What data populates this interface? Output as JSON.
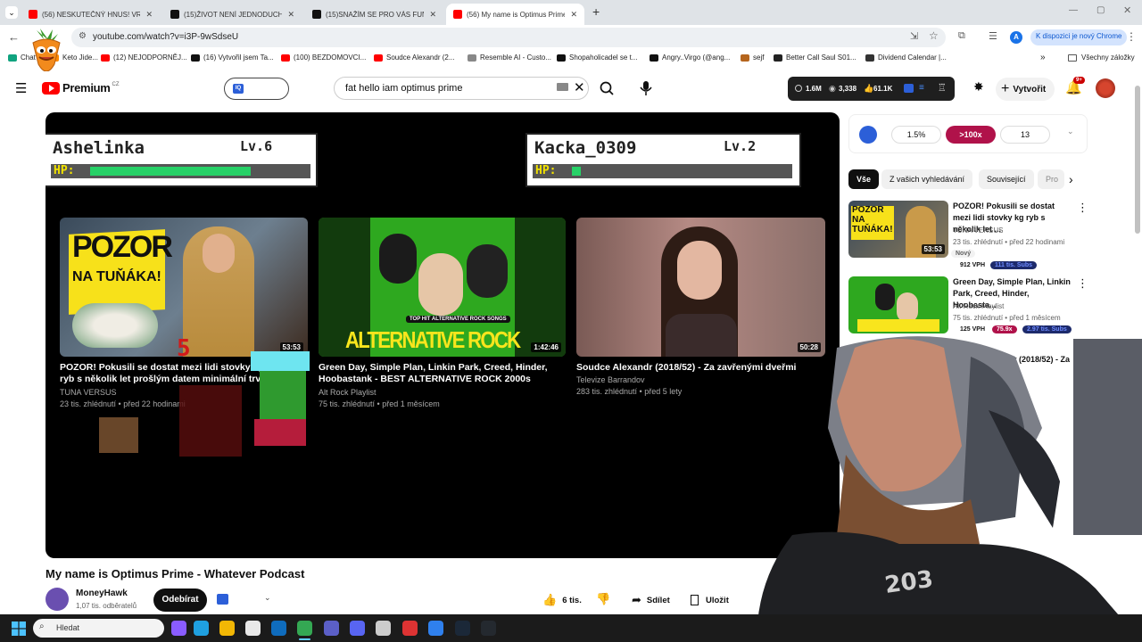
{
  "browser": {
    "tabs": [
      {
        "title": "(56) NESKUTEČNÝ HNUS! VRCH",
        "icon": "youtube-icon",
        "color": "#ff0000",
        "active": false
      },
      {
        "title": "(15)ŽIVOT NENÍ JEDNODUCHÝ",
        "icon": "tiktok-icon",
        "color": "#111111",
        "active": false
      },
      {
        "title": "(15)SNAŽÍM SE PRO VÁS FUNG",
        "icon": "tiktok-icon",
        "color": "#111111",
        "active": false
      },
      {
        "title": "(56) My name is Optimus Prime",
        "icon": "youtube-icon",
        "color": "#ff0000",
        "active": true
      }
    ],
    "new_tab": "+",
    "url": "youtube.com/watch?v=i3P-9wSdseU",
    "profile_letter": "A",
    "chrome_update": "K dispozici je nový Chrome",
    "bookmarks": [
      {
        "label": "Chat",
        "color": "#10a37f"
      },
      {
        "label": "Keto Jide...",
        "color": "#ff8a00"
      },
      {
        "label": "(12) NEJODPORNĚJ...",
        "color": "#ff0000"
      },
      {
        "label": "(16) Vytvořil jsem Ta...",
        "color": "#111111"
      },
      {
        "label": "(100) BEZDOMOVCI...",
        "color": "#ff0000"
      },
      {
        "label": "Soudce Alexandr (2...",
        "color": "#ff0000"
      },
      {
        "label": "Resemble AI - Custo...",
        "color": "#888888"
      },
      {
        "label": "Shopaholicadel se t...",
        "color": "#111111"
      },
      {
        "label": "Angry..Virgo (@ang...",
        "color": "#111111"
      },
      {
        "label": "sejf",
        "color": "#b5651d"
      },
      {
        "label": "Better Call Saul S01...",
        "color": "#222222"
      },
      {
        "label": "Dividend Calendar |...",
        "color": "#333333"
      }
    ],
    "bookmarks_overflow": "»",
    "all_bookmarks": "Všechny záložky"
  },
  "youtube": {
    "logo_text": "Premium",
    "logo_region": "CZ",
    "search_query": "fat hello iam optimus prime",
    "stats": {
      "views": "1.6M",
      "viewers": "3,338",
      "likes": "61.1K"
    },
    "create_label": "Vytvořit",
    "notifications": "9+",
    "iq_label": "IQ"
  },
  "player": {
    "hp_left": {
      "name": "Ashelinka",
      "level": "Lv.6",
      "hp_label": "HP:",
      "hp_fraction": 0.74
    },
    "hp_right": {
      "name": "Kacka_0309",
      "level": "Lv.2",
      "hp_label": "HP:",
      "hp_fraction": 0.04
    },
    "endcards": [
      {
        "title": "POZOR! Pokusili se dostat mezi lidi stovky kg ryb s několik let prošlým datem minimální trv",
        "channel": "TUNA VERSUS",
        "meta": "23 tis. zhlédnutí • před 22 hodinami",
        "duration": "53:53",
        "thumb_text1": "POZOR",
        "thumb_text2": "NA TUŇÁKA!"
      },
      {
        "title": "Green Day, Simple Plan, Linkin Park, Creed, Hinder, Hoobastank - BEST ALTERNATIVE ROCK 2000s",
        "channel": "Alt Rock Playlist",
        "meta": "75 tis. zhlédnutí • před 1 měsícem",
        "duration": "1:42:46",
        "thumb_text1": "ALTERNATIVE ROCK",
        "thumb_text2": "TOP HIT ALTERNATIVE ROCK SONGS"
      },
      {
        "title": "Soudce Alexandr (2018/52) - Za zavřenými dveřmi",
        "channel": "Televize Barrandov",
        "meta": "283 tis. zhlédnutí • před 5 lety",
        "duration": "50:28"
      }
    ],
    "overlay_number": "5"
  },
  "video": {
    "title": "My name is Optimus Prime - Whatever Podcast",
    "channel": "MoneyHawk",
    "subscribers": "1,07 tis. odběratelů",
    "subscribe_label": "Odebírat",
    "likes": "6 tis.",
    "share_label": "Sdílet",
    "save_label": "Uložit"
  },
  "sidebar": {
    "iq_stats": {
      "pct": "1.5%",
      "ratio": ">100x",
      "count": "13"
    },
    "chips": [
      "Vše",
      "Z vašich vyhledávání",
      "Související",
      "Pro"
    ],
    "items": [
      {
        "title": "POZOR! Pokusili se dostat mezi lidi stovky kg ryb s několik let ...",
        "channel": "TUNA VERSUS",
        "meta": "23 tis. zhlédnutí • před 22 hodinami",
        "badge_new": "Nový",
        "vph": "912 VPH",
        "subs": "111 tis. Subs",
        "duration": "53:53",
        "thumb_text": "POZOR NA TUŇÁKA!"
      },
      {
        "title": "Green Day, Simple Plan, Linkin Park, Creed, Hinder, Hoobasta...",
        "channel": "Alt Rock Playlist",
        "meta": "75 tis. zhlédnutí • před 1 měsícem",
        "vph": "125 VPH",
        "ratio": "75.9x",
        "subs": "2.97 tis. Subs"
      },
      {
        "title": "Alexandr (2018/52) - Za",
        "channel": "",
        "meta": ""
      }
    ]
  },
  "taskbar": {
    "search_placeholder": "Hledat",
    "icons": [
      "windows-icon",
      "copilot-icon",
      "edge-icon",
      "explorer-icon",
      "store-icon",
      "outlook-icon",
      "chrome-icon",
      "teams-icon",
      "discord-icon",
      "wikipedia-icon",
      "obs-icon",
      "vpn-icon",
      "steam-icon",
      "github-icon"
    ]
  }
}
